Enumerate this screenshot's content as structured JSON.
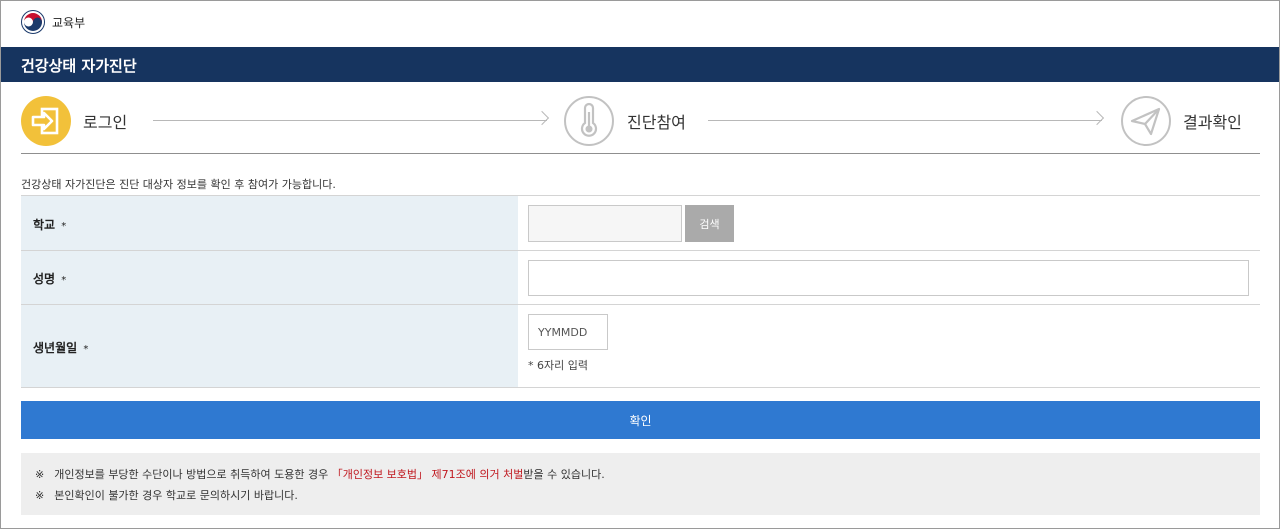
{
  "header": {
    "ministry": "교육부"
  },
  "title": "건강상태 자가진단",
  "steps": [
    {
      "label": "로그인",
      "icon": "login-icon",
      "active": true
    },
    {
      "label": "진단참여",
      "icon": "thermometer-icon",
      "active": false
    },
    {
      "label": "결과확인",
      "icon": "send-icon",
      "active": false
    }
  ],
  "notice": "건강상태 자가진단은 진단 대상자 정보를 확인 후 참여가 가능합니다.",
  "form": {
    "required_mark": "*",
    "school": {
      "label": "학교",
      "value": "",
      "search_label": "검색"
    },
    "name": {
      "label": "성명",
      "value": ""
    },
    "birth": {
      "label": "생년월일",
      "placeholder": "YYMMDD",
      "hint": "* 6자리 입력"
    }
  },
  "confirm_label": "확인",
  "info": {
    "mark": "※",
    "line1_pre": "개인정보를 부당한 수단이나 방법으로 취득하여 도용한 경우 ",
    "line1_red": "「개인정보 보호법」 제71조에 의거 처벌",
    "line1_post": "받을 수 있습니다.",
    "line2": "본인확인이 불가한 경우 학교로 문의하시기 바랍니다."
  },
  "colors": {
    "title_bar": "#16345f",
    "active_step": "#f2c13a",
    "confirm_button": "#2f79d1",
    "warning_text": "#c0181f"
  }
}
